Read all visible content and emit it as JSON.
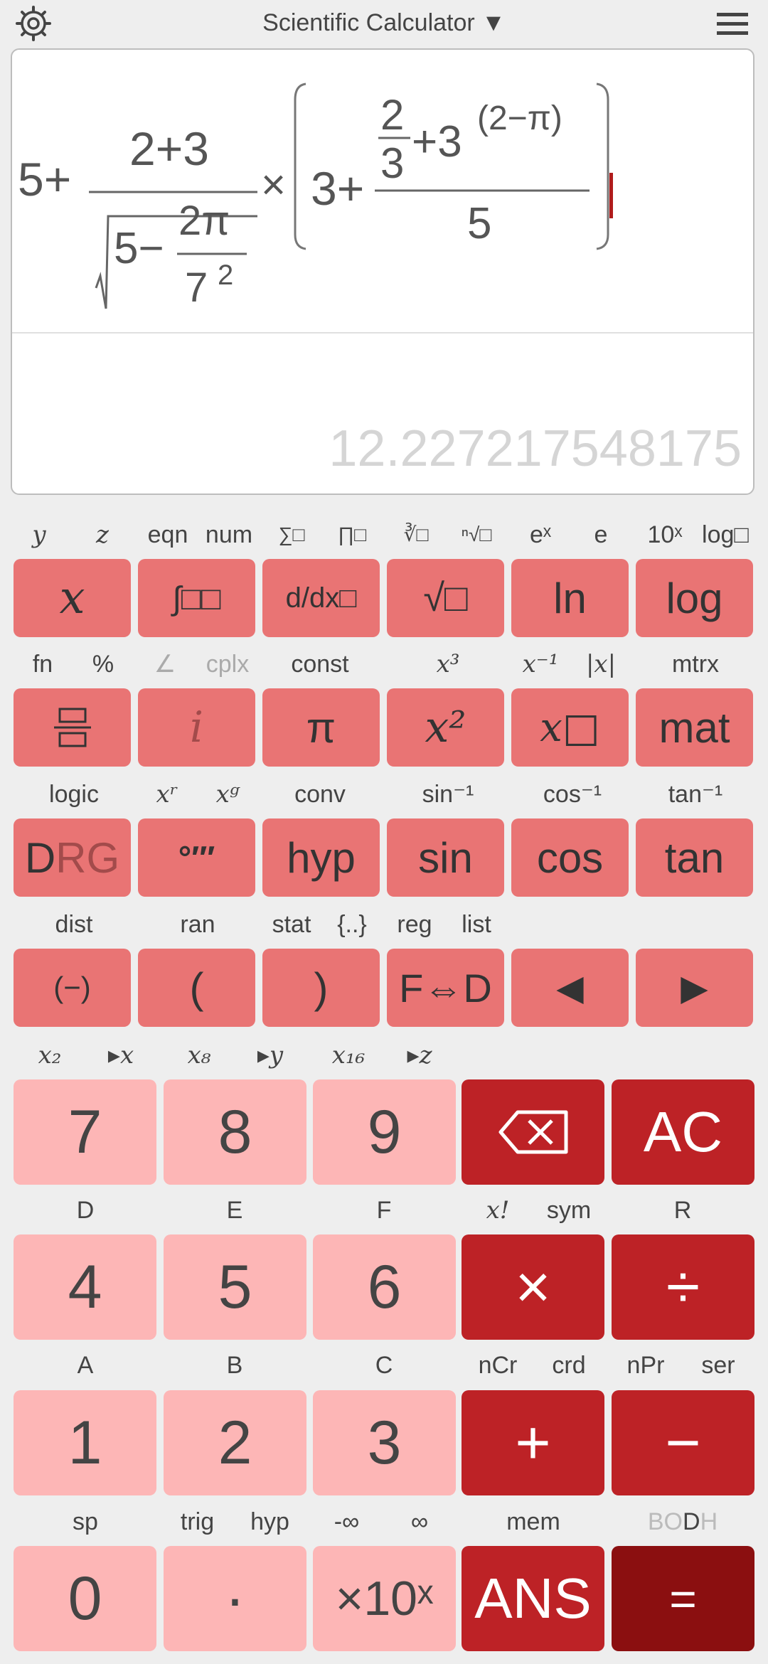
{
  "header": {
    "title": "Scientific Calculator ▼",
    "settings_icon": "settings-gear-icon",
    "menu_icon": "hamburger-menu-icon"
  },
  "display": {
    "result": "12.227217548175",
    "expression": {
      "t5plus": "5+",
      "num23": "2+3",
      "sqrt5": "5−",
      "twopi": "2π",
      "seven": "7",
      "sq": "2",
      "times": "×",
      "three": "3+",
      "f2": "2",
      "f3": "3",
      "plus3": "+3",
      "exp": "(2−π)",
      "five": "5"
    }
  },
  "row1_labels": [
    "y",
    "z",
    "eqn",
    "num",
    "∑□",
    "∏□",
    "∛□",
    "ⁿ√□",
    "eˣ",
    "e",
    "10ˣ",
    "log□"
  ],
  "row1_keys": [
    "x",
    "∫□□",
    "d/dx□",
    "√□",
    "ln",
    "log"
  ],
  "row2_labels": [
    "fn",
    "%",
    "∠",
    "cplx",
    "const",
    "x³",
    "x⁻¹",
    "|x|",
    "mtrx"
  ],
  "row2_keys": [
    "frac",
    "i",
    "π",
    "x²",
    "x□",
    "mat"
  ],
  "row3_labels": [
    "logic",
    "xʳ",
    "xᵍ",
    "conv",
    "sin⁻¹",
    "cos⁻¹",
    "tan⁻¹"
  ],
  "row3_keys": [
    "DRG",
    "°′″",
    "hyp",
    "sin",
    "cos",
    "tan"
  ],
  "row4_labels": [
    "dist",
    "ran",
    "stat",
    "{..}",
    "reg",
    "list"
  ],
  "row4_keys": [
    "(−)",
    "(",
    ")",
    "F⇔D",
    "◀",
    "▶"
  ],
  "row5_labels": [
    "x₂",
    "▸x",
    "x₈",
    "▸y",
    "x₁₆",
    "▸z"
  ],
  "row5_keys": [
    "7",
    "8",
    "9",
    "⌫",
    "AC"
  ],
  "row6_labels": [
    "D",
    "E",
    "F",
    "x!",
    "sym",
    "R"
  ],
  "row6_keys": [
    "4",
    "5",
    "6",
    "×",
    "÷"
  ],
  "row7_labels": [
    "A",
    "B",
    "C",
    "nCr",
    "crd",
    "nPr",
    "ser"
  ],
  "row7_keys": [
    "1",
    "2",
    "3",
    "+",
    "−"
  ],
  "row8_labels": [
    "sp",
    "trig",
    "hyp",
    "-∞",
    "∞",
    "mem",
    "BODH"
  ],
  "row8_keys": [
    "0",
    "·",
    "×10ˣ",
    "ANS",
    "="
  ],
  "colors": {
    "fn_key": "#e97474",
    "num_key": "#fdb6b6",
    "op_key": "#bd2226",
    "eq_key": "#8b0f10",
    "cursor": "#b01c1c"
  }
}
